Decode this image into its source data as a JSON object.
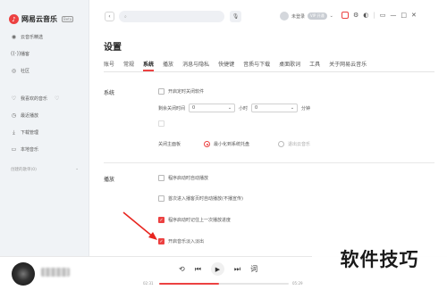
{
  "app": {
    "name": "网易云音乐",
    "badge": "Beta"
  },
  "sidebar": {
    "items": [
      {
        "label": "云音乐精选",
        "icon": "music-disc-icon"
      },
      {
        "label": "播客",
        "icon": "podcast-icon"
      },
      {
        "label": "社区",
        "icon": "community-icon"
      }
    ],
    "my_items": [
      {
        "label": "我喜欢的音乐",
        "icon": "heart-icon"
      },
      {
        "label": "最近播放",
        "icon": "clock-icon"
      },
      {
        "label": "下载管理",
        "icon": "download-icon"
      },
      {
        "label": "本地音乐",
        "icon": "folder-icon"
      }
    ],
    "created_header": "创建的歌单(0)"
  },
  "topbar": {
    "search_placeholder": "",
    "login_text": "未登录",
    "vip_badge": "VIP 开通"
  },
  "settings": {
    "title": "设置",
    "tabs": [
      "账号",
      "常规",
      "系统",
      "播放",
      "消息与隐私",
      "快捷键",
      "音质与下载",
      "桌面歌词",
      "工具",
      "关于网易云音乐"
    ],
    "active_tab": "系统",
    "system": {
      "label": "系统",
      "auto_shutdown": "开启定时关闭软件",
      "remaining_label": "剩余关闭时间",
      "hours_value": "0",
      "hours_unit": "小时",
      "minutes_value": "0",
      "minutes_unit": "分钟",
      "close_panel_label": "关闭主面板",
      "minimize_option": "最小化到系统托盘",
      "exit_option": "退出云音乐"
    },
    "play": {
      "label": "播放",
      "options": [
        {
          "label": "程序启动时自动播放",
          "checked": false
        },
        {
          "label": "首次进入播客页时自动播放(不播宣传)",
          "checked": false
        },
        {
          "label": "程序启动时记住上一次播放进度",
          "checked": true
        },
        {
          "label": "开启音乐淡入淡出",
          "checked": true
        }
      ]
    }
  },
  "player": {
    "time_current": "02:31",
    "time_total": "05:29",
    "progress": 0.46,
    "lyrics_label": "词"
  },
  "watermark": "软件技巧",
  "colors": {
    "accent": "#ec4141"
  }
}
